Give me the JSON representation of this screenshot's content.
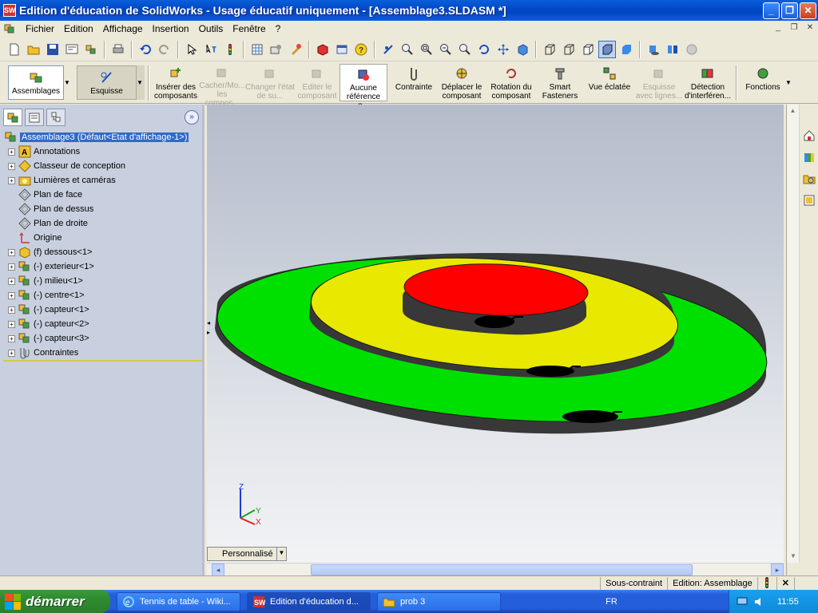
{
  "window": {
    "title": "Edition d'éducation de SolidWorks - Usage éducatif uniquement - [Assemblage3.SLDASM *]",
    "app_icon": "SW"
  },
  "menu": {
    "items": [
      "Fichier",
      "Edition",
      "Affichage",
      "Insertion",
      "Outils",
      "Fenêtre",
      "?"
    ]
  },
  "command_manager": {
    "tabs": [
      {
        "label": "Assemblages"
      },
      {
        "label": "Esquisse"
      }
    ],
    "buttons": [
      {
        "label": "Insérer des composants",
        "enabled": true,
        "icon": "insert-components-icon"
      },
      {
        "label": "Cacher/Mo... les compos...",
        "enabled": false,
        "icon": "hide-show-icon"
      },
      {
        "label": "Changer l'état de su...",
        "enabled": false,
        "icon": "change-state-icon"
      },
      {
        "label": "Editer le composant",
        "enabled": false,
        "icon": "edit-component-icon"
      },
      {
        "label": "Aucune référence e...",
        "enabled": true,
        "icon": "no-external-refs-icon",
        "selected": true
      },
      {
        "label": "Contrainte",
        "enabled": true,
        "icon": "mate-icon"
      },
      {
        "label": "Déplacer le composant",
        "enabled": true,
        "icon": "move-component-icon"
      },
      {
        "label": "Rotation du composant",
        "enabled": true,
        "icon": "rotate-component-icon"
      },
      {
        "label": "Smart Fasteners",
        "enabled": true,
        "icon": "smart-fasteners-icon"
      },
      {
        "label": "Vue éclatée",
        "enabled": true,
        "icon": "exploded-view-icon"
      },
      {
        "label": "Esquisse avec lignes...",
        "enabled": false,
        "icon": "explode-line-sketch-icon"
      },
      {
        "label": "Détection d'interféren...",
        "enabled": true,
        "icon": "interference-detection-icon"
      },
      {
        "label": "Fonctions",
        "enabled": true,
        "icon": "features-icon"
      }
    ]
  },
  "feature_tree": {
    "root": "Assemblage3  (Défaut<Etat d'affichage-1>)",
    "items": [
      {
        "label": "Annotations",
        "expandable": true,
        "icon": "annotations-icon"
      },
      {
        "label": "Classeur de conception",
        "expandable": true,
        "icon": "design-binder-icon"
      },
      {
        "label": "Lumières et caméras",
        "expandable": true,
        "icon": "lights-cameras-icon"
      },
      {
        "label": "Plan de face",
        "expandable": false,
        "icon": "plane-icon"
      },
      {
        "label": "Plan de dessus",
        "expandable": false,
        "icon": "plane-icon"
      },
      {
        "label": "Plan de droite",
        "expandable": false,
        "icon": "plane-icon"
      },
      {
        "label": "Origine",
        "expandable": false,
        "icon": "origin-icon"
      },
      {
        "label": "(f) dessous<1>",
        "expandable": true,
        "icon": "fixed-part-icon"
      },
      {
        "label": "(-) exterieur<1>",
        "expandable": true,
        "icon": "component-icon"
      },
      {
        "label": "(-) milieu<1>",
        "expandable": true,
        "icon": "component-icon"
      },
      {
        "label": "(-) centre<1>",
        "expandable": true,
        "icon": "component-icon"
      },
      {
        "label": "(-) capteur<1>",
        "expandable": true,
        "icon": "component-icon"
      },
      {
        "label": "(-) capteur<2>",
        "expandable": true,
        "icon": "component-icon"
      },
      {
        "label": "(-) capteur<3>",
        "expandable": true,
        "icon": "component-icon"
      },
      {
        "label": "Contraintes",
        "expandable": true,
        "icon": "mates-icon"
      }
    ]
  },
  "graphics": {
    "configuration": "Personnalisé",
    "colors": {
      "outer": "#00e000",
      "middle": "#e8e800",
      "center": "#ff0000",
      "shadow": "#383838"
    },
    "triad": {
      "z": "Z",
      "y": "Y",
      "x": "X"
    }
  },
  "status": {
    "constraint": "Sous-contraint",
    "mode": "Edition: Assemblage"
  },
  "taskbar": {
    "start": "démarrer",
    "tasks": [
      {
        "label": "Tennis de table - Wiki...",
        "icon": "ie-icon"
      },
      {
        "label": "Edition d'éducation d...",
        "icon": "solidworks-icon",
        "active": true
      },
      {
        "label": "prob 3",
        "icon": "folder-icon"
      }
    ],
    "lang": "FR",
    "clock": "11:55"
  }
}
